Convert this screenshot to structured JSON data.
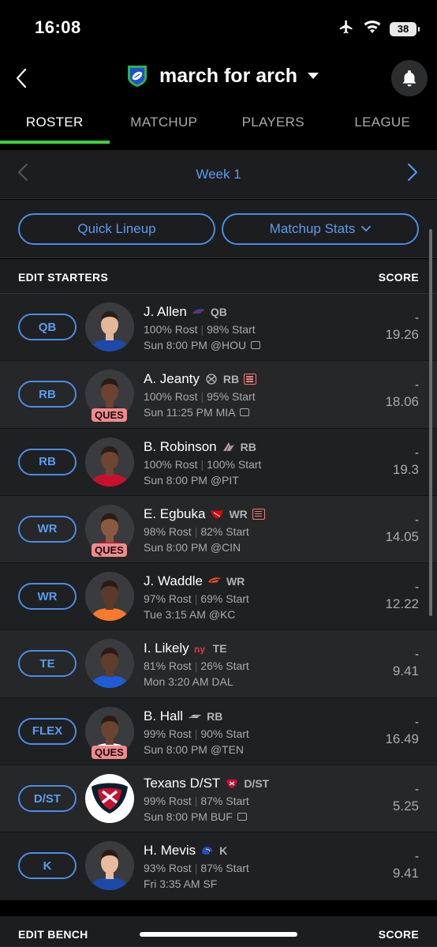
{
  "status": {
    "time": "16:08",
    "battery": "38"
  },
  "header": {
    "league_name": "march for arch"
  },
  "tabs": [
    "ROSTER",
    "MATCHUP",
    "PLAYERS",
    "LEAGUE"
  ],
  "week": {
    "label": "Week 1"
  },
  "actions": {
    "quick_lineup": "Quick Lineup",
    "matchup_stats": "Matchup Stats"
  },
  "starters_header": {
    "left": "EDIT STARTERS",
    "right": "SCORE"
  },
  "bench_header": {
    "left": "EDIT BENCH",
    "right": "SCORE"
  },
  "colors": {
    "accent_blue": "#5b9cf0",
    "tab_green": "#3dd13d",
    "ques_red": "#f08a8e"
  },
  "players": [
    {
      "slot": "QB",
      "name": "J. Allen",
      "team_icon": "bills-icon",
      "pos": "QB",
      "rost": "100% Rost",
      "start": "98% Start",
      "game": "Sun 8:00 PM @HOU",
      "tv": true,
      "news": false,
      "status": "",
      "score_dash": "-",
      "score": "19.26",
      "skin": "#e2b79a",
      "jersey": "#1d4aa8"
    },
    {
      "slot": "RB",
      "name": "A. Jeanty",
      "team_icon": "raiders-icon",
      "pos": "RB",
      "rost": "100% Rost",
      "start": "95% Start",
      "game": "Sun 11:25 PM MIA",
      "tv": true,
      "news": true,
      "status": "QUES",
      "score_dash": "-",
      "score": "18.06",
      "skin": "#6b4330",
      "jersey": "#2a2a2a"
    },
    {
      "slot": "RB",
      "name": "B. Robinson",
      "team_icon": "falcons-icon",
      "pos": "RB",
      "rost": "100% Rost",
      "start": "100% Start",
      "game": "Sun 8:00 PM @PIT",
      "tv": false,
      "news": false,
      "status": "",
      "score_dash": "-",
      "score": "19.3",
      "skin": "#6e4532",
      "jersey": "#c8102e"
    },
    {
      "slot": "WR",
      "name": "E. Egbuka",
      "team_icon": "buccaneers-icon",
      "pos": "WR",
      "rost": "98% Rost",
      "start": "82% Start",
      "game": "Sun 8:00 PM @CIN",
      "tv": false,
      "news": true,
      "status": "QUES",
      "score_dash": "-",
      "score": "14.05",
      "skin": "#8a5a40",
      "jersey": "#a71930"
    },
    {
      "slot": "WR",
      "name": "J. Waddle",
      "team_icon": "broncos-icon",
      "pos": "WR",
      "rost": "97% Rost",
      "start": "69% Start",
      "game": "Tue 3:15 AM @KC",
      "tv": false,
      "news": false,
      "status": "",
      "score_dash": "-",
      "score": "12.22",
      "skin": "#5a3a2a",
      "jersey": "#fb7a2b"
    },
    {
      "slot": "TE",
      "name": "I. Likely",
      "team_icon": "giants-icon",
      "pos": "TE",
      "rost": "81% Rost",
      "start": "26% Start",
      "game": "Mon 3:20 AM DAL",
      "tv": false,
      "news": false,
      "status": "",
      "score_dash": "-",
      "score": "9.41",
      "skin": "#5e3d2c",
      "jersey": "#1e5bd8"
    },
    {
      "slot": "FLEX",
      "name": "B. Hall",
      "team_icon": "jets-icon",
      "pos": "RB",
      "rost": "99% Rost",
      "start": "90% Start",
      "game": "Sun 8:00 PM @TEN",
      "tv": false,
      "news": false,
      "status": "QUES",
      "score_dash": "-",
      "score": "16.49",
      "skin": "#6a4431",
      "jersey": "#ffffff"
    },
    {
      "slot": "D/ST",
      "name": "Texans D/ST",
      "team_icon": "texans-icon",
      "pos": "D/ST",
      "rost": "99% Rost",
      "start": "87% Start",
      "game": "Sun 8:00 PM BUF",
      "tv": true,
      "news": false,
      "status": "",
      "score_dash": "-",
      "score": "5.25",
      "skin": "",
      "jersey": ""
    },
    {
      "slot": "K",
      "name": "H. Mevis",
      "team_icon": "rams-icon",
      "pos": "K",
      "rost": "93% Rost",
      "start": "87% Start",
      "game": "Fri 3:35 AM SF",
      "tv": false,
      "news": false,
      "status": "",
      "score_dash": "-",
      "score": "9.41",
      "skin": "#e6bba0",
      "jersey": "#1d4aa8"
    }
  ]
}
